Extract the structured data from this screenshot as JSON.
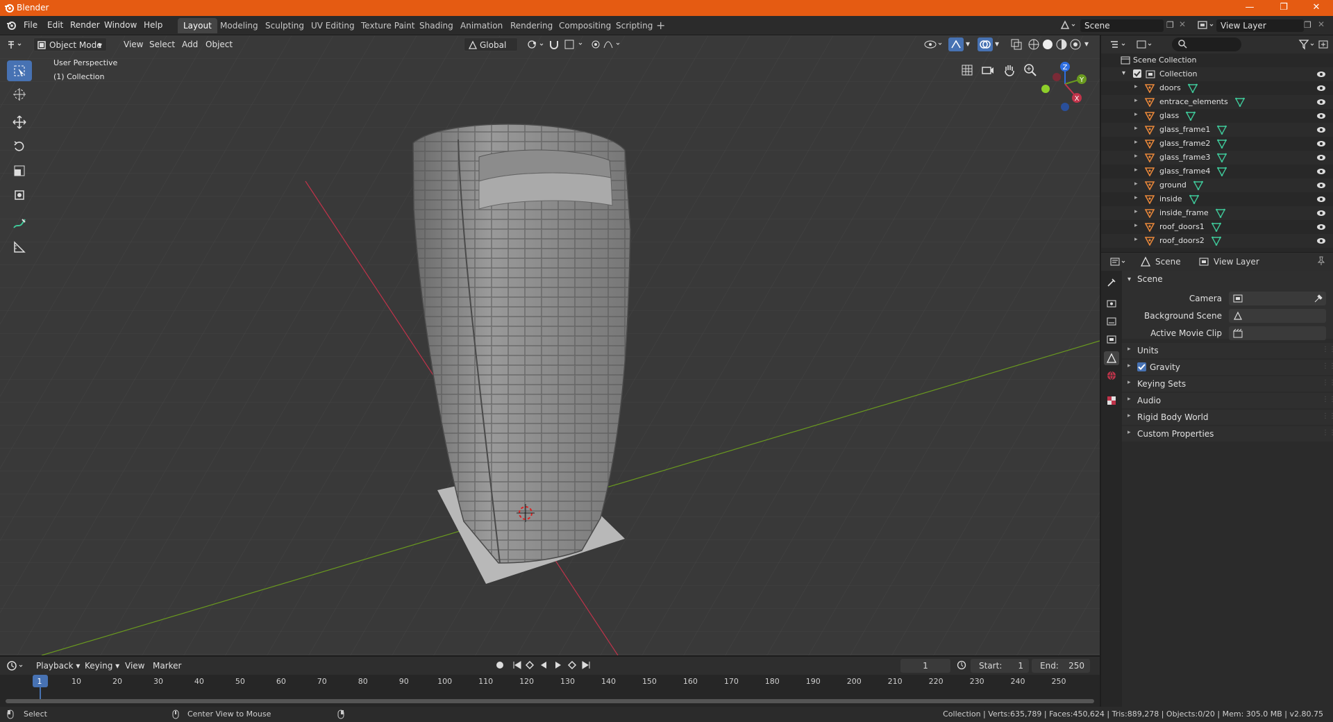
{
  "window": {
    "title": "Blender"
  },
  "menu": [
    "File",
    "Edit",
    "Render",
    "Window",
    "Help"
  ],
  "workspaces": [
    "Layout",
    "Modeling",
    "Sculpting",
    "UV Editing",
    "Texture Paint",
    "Shading",
    "Animation",
    "Rendering",
    "Compositing",
    "Scripting"
  ],
  "active_workspace": "Layout",
  "scene_field": "Scene",
  "view_layer_field": "View Layer",
  "viewport": {
    "mode": "Object Mode",
    "menus": [
      "View",
      "Select",
      "Add",
      "Object"
    ],
    "orientation": "Global",
    "info_line1": "User Perspective",
    "info_line2": "(1) Collection",
    "gizmo_axes": {
      "z": "Z",
      "y": "Y",
      "x": "X"
    }
  },
  "outliner": {
    "root": "Scene Collection",
    "collection": "Collection",
    "items": [
      "doors",
      "entrace_elements",
      "glass",
      "glass_frame1",
      "glass_frame2",
      "glass_frame3",
      "glass_frame4",
      "ground",
      "inside",
      "inside_frame",
      "roof_doors1",
      "roof_doors2"
    ]
  },
  "properties": {
    "tab_scene": "Scene",
    "tab_view_layer": "View Layer",
    "panel_title": "Scene",
    "camera_label": "Camera",
    "background_scene_label": "Background Scene",
    "active_movie_clip_label": "Active Movie Clip",
    "subpanels": [
      "Units",
      "Gravity",
      "Keying Sets",
      "Audio",
      "Rigid Body World",
      "Custom Properties"
    ],
    "gravity_checked": true
  },
  "timeline": {
    "menus": [
      "Playback",
      "Keying",
      "View",
      "Marker"
    ],
    "current_frame": "1",
    "start_label": "Start:",
    "start_value": "1",
    "end_label": "End:",
    "end_value": "250",
    "ruler": [
      "1",
      "10",
      "20",
      "30",
      "40",
      "50",
      "60",
      "70",
      "80",
      "90",
      "100",
      "110",
      "120",
      "130",
      "140",
      "150",
      "160",
      "170",
      "180",
      "190",
      "200",
      "210",
      "220",
      "230",
      "240",
      "250"
    ]
  },
  "statusbar": {
    "left1": "Select",
    "left2": "Center View to Mouse",
    "right": "Collection | Verts:635,789 | Faces:450,624 | Tris:889,278 | Objects:0/20 | Mem: 305.0 MB | v2.80.75"
  },
  "colors": {
    "title_bar": "#e55b12",
    "accent": "#4772b3",
    "x_axis": "#c0334a",
    "y_axis": "#6a9a1f",
    "z_axis": "#2e6ee0",
    "object_icon": "#e8873a",
    "mesh_icon": "#3fc99a"
  }
}
